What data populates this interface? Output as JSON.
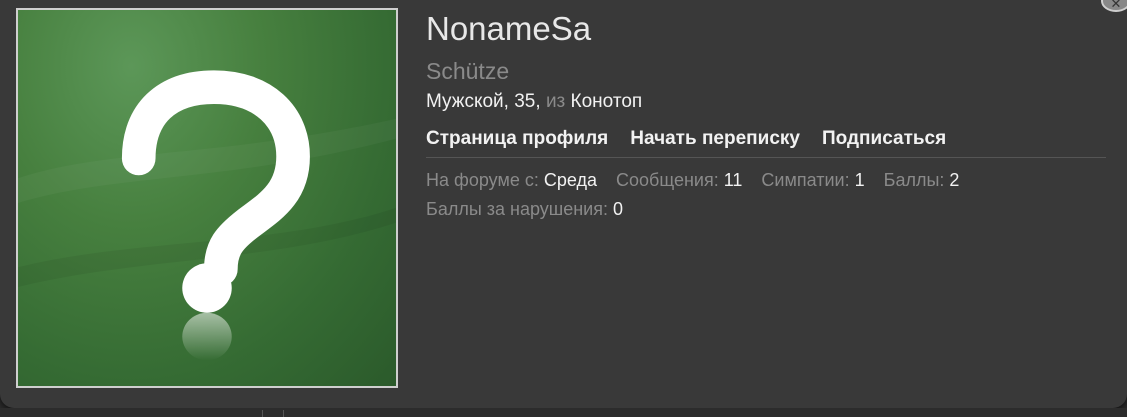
{
  "profile": {
    "username": "NonameSa",
    "title": "Schütze",
    "gender": "Мужской",
    "age": "35",
    "from_word": "из",
    "location": "Конотоп"
  },
  "links": {
    "profile_page": "Страница профиля",
    "start_conversation": "Начать переписку",
    "follow": "Подписаться"
  },
  "stats": {
    "joined_label": "На форуме с:",
    "joined_value": "Среда",
    "messages_label": "Сообщения:",
    "messages_value": "11",
    "likes_label": "Симпатии:",
    "likes_value": "1",
    "points_label": "Баллы:",
    "points_value": "2",
    "warning_points_label": "Баллы за нарушения:",
    "warning_points_value": "0"
  },
  "icons": {
    "avatar": "question-mark-placeholder-avatar",
    "close": "close-icon"
  },
  "colors": {
    "card_background": "#393939",
    "avatar_green": "#47803f",
    "text_primary": "#f2f2f2",
    "text_muted": "#8a8a8a"
  }
}
